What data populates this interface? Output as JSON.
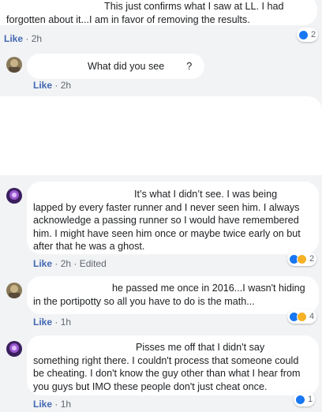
{
  "comments": [
    {
      "lines": [
        "This just confirms what I saw at LL. I had",
        "forgotten about it...I am in favor of removing the results."
      ],
      "like_label": "Like",
      "time": "2h",
      "edited": "",
      "reaction_count": "2"
    },
    {
      "lines": [
        "What did you see        ?"
      ],
      "like_label": "Like",
      "time": "2h"
    },
    {
      "lines": [
        "It’s what I didn’t see. I was being",
        "lapped by every faster runner and I never seen him. I always",
        "acknowledge a passing runner so I would have remembered",
        "him. I might have seen him once or maybe twice early on but",
        "after that he was a ghost."
      ],
      "like_label": "Like",
      "time": "2h",
      "edited": "Edited",
      "reaction_count": "2"
    },
    {
      "lines": [
        "he passed me once in 2016...I wasn't hiding",
        "in the portipotty so all you have to do is the math..."
      ],
      "like_label": "Like",
      "time": "1h",
      "reaction_count": "4"
    },
    {
      "lines": [
        "Pisses me off that I didn't say",
        "something right there. I couldn't process that someone could",
        "be cheating. I don't know the guy other than what I hear from",
        "you guys but IMO these people don't just cheat once."
      ],
      "like_label": "Like",
      "time": "1h",
      "reaction_count": "1"
    }
  ],
  "separator": "·",
  "icons": {
    "like": "like-reaction-icon",
    "wow": "wow-reaction-icon",
    "haha": "haha-reaction-icon"
  },
  "colors": {
    "like_blue": "#1877f2",
    "link_blue": "#4267b2",
    "emoji_yellow": "#f7b125"
  }
}
